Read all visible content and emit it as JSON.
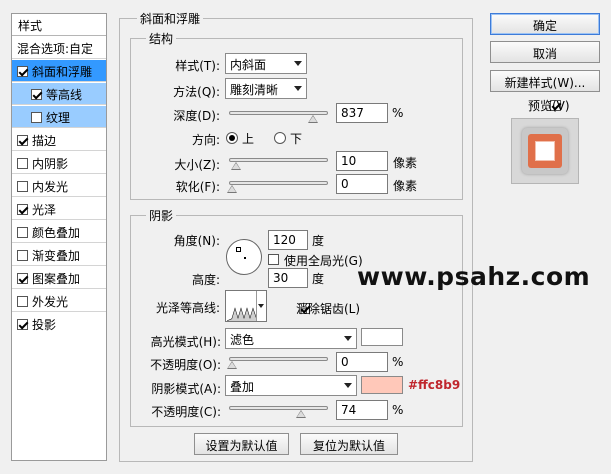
{
  "styles_panel": {
    "title": "样式",
    "blend_options": "混合选项:自定",
    "items": [
      {
        "label": "斜面和浮雕",
        "checked": true
      },
      {
        "label": "等高线",
        "checked": true
      },
      {
        "label": "纹理",
        "checked": false
      },
      {
        "label": "描边",
        "checked": true
      },
      {
        "label": "内阴影",
        "checked": false
      },
      {
        "label": "内发光",
        "checked": false
      },
      {
        "label": "光泽",
        "checked": true
      },
      {
        "label": "颜色叠加",
        "checked": false
      },
      {
        "label": "渐变叠加",
        "checked": false
      },
      {
        "label": "图案叠加",
        "checked": true
      },
      {
        "label": "外发光",
        "checked": false
      },
      {
        "label": "投影",
        "checked": true
      }
    ]
  },
  "bevel": {
    "title": "斜面和浮雕",
    "structure": {
      "title": "结构",
      "style_label": "样式(T):",
      "style_value": "内斜面",
      "technique_label": "方法(Q):",
      "technique_value": "雕刻清晰",
      "depth_label": "深度(D):",
      "depth_value": "837",
      "depth_unit": "%",
      "depth_level": 0.87,
      "direction_label": "方向:",
      "direction_up": "上",
      "direction_down": "下",
      "size_label": "大小(Z):",
      "size_value": "10",
      "size_unit": "像素",
      "size_level": 0.04,
      "soften_label": "软化(F):",
      "soften_value": "0",
      "soften_unit": "像素",
      "soften_level": 0.0
    },
    "shading": {
      "title": "阴影",
      "angle_label": "角度(N):",
      "angle_value": "120",
      "angle_unit": "度",
      "global_light_label": "使用全局光(G)",
      "altitude_label": "高度:",
      "altitude_value": "30",
      "altitude_unit": "度",
      "gloss_contour_label": "光泽等高线:",
      "antialias_label": "消除锯齿(L)",
      "highlight_mode_label": "高光模式(H):",
      "highlight_mode_value": "滤色",
      "highlight_color": "#ffffff",
      "highlight_opacity_label": "不透明度(O):",
      "highlight_opacity_value": "0",
      "highlight_opacity_unit": "%",
      "highlight_opacity_level": 0.0,
      "shadow_mode_label": "阴影模式(A):",
      "shadow_mode_value": "叠加",
      "shadow_color": "#ffc8b9",
      "shadow_color_text": "#ffc8b9",
      "shadow_opacity_label": "不透明度(C):",
      "shadow_opacity_value": "74",
      "shadow_opacity_unit": "%",
      "shadow_opacity_level": 0.74
    },
    "make_default": "设置为默认值",
    "reset_default": "复位为默认值"
  },
  "buttons": {
    "ok": "确定",
    "cancel": "取消",
    "new_style": "新建样式(W)...",
    "preview_label": "预览(V)"
  },
  "watermark": "www.psahz.com",
  "colors": {
    "accent": "#3399ff",
    "swatch_text": "#c0262d",
    "preview_orange": "#e0704a"
  }
}
